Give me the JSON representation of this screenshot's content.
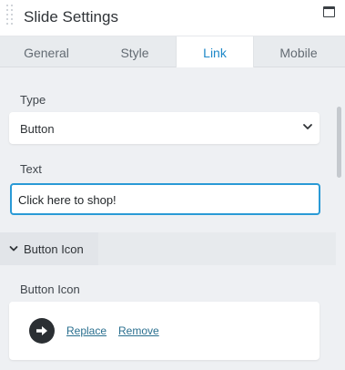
{
  "header": {
    "title": "Slide Settings"
  },
  "tabs": [
    {
      "label": "General"
    },
    {
      "label": "Style"
    },
    {
      "label": "Link"
    },
    {
      "label": "Mobile"
    }
  ],
  "active_tab": "Link",
  "fields": {
    "type": {
      "label": "Type",
      "value": "Button"
    },
    "text": {
      "label": "Text",
      "value": "Click here to shop!"
    }
  },
  "section": {
    "title": "Button Icon",
    "field_label": "Button Icon",
    "icon": "arrow-circle-right-icon",
    "replace_label": "Replace",
    "remove_label": "Remove"
  },
  "colors": {
    "accent": "#1e88c8",
    "focus_border": "#2a9ad6",
    "link": "#2a6f8f"
  }
}
